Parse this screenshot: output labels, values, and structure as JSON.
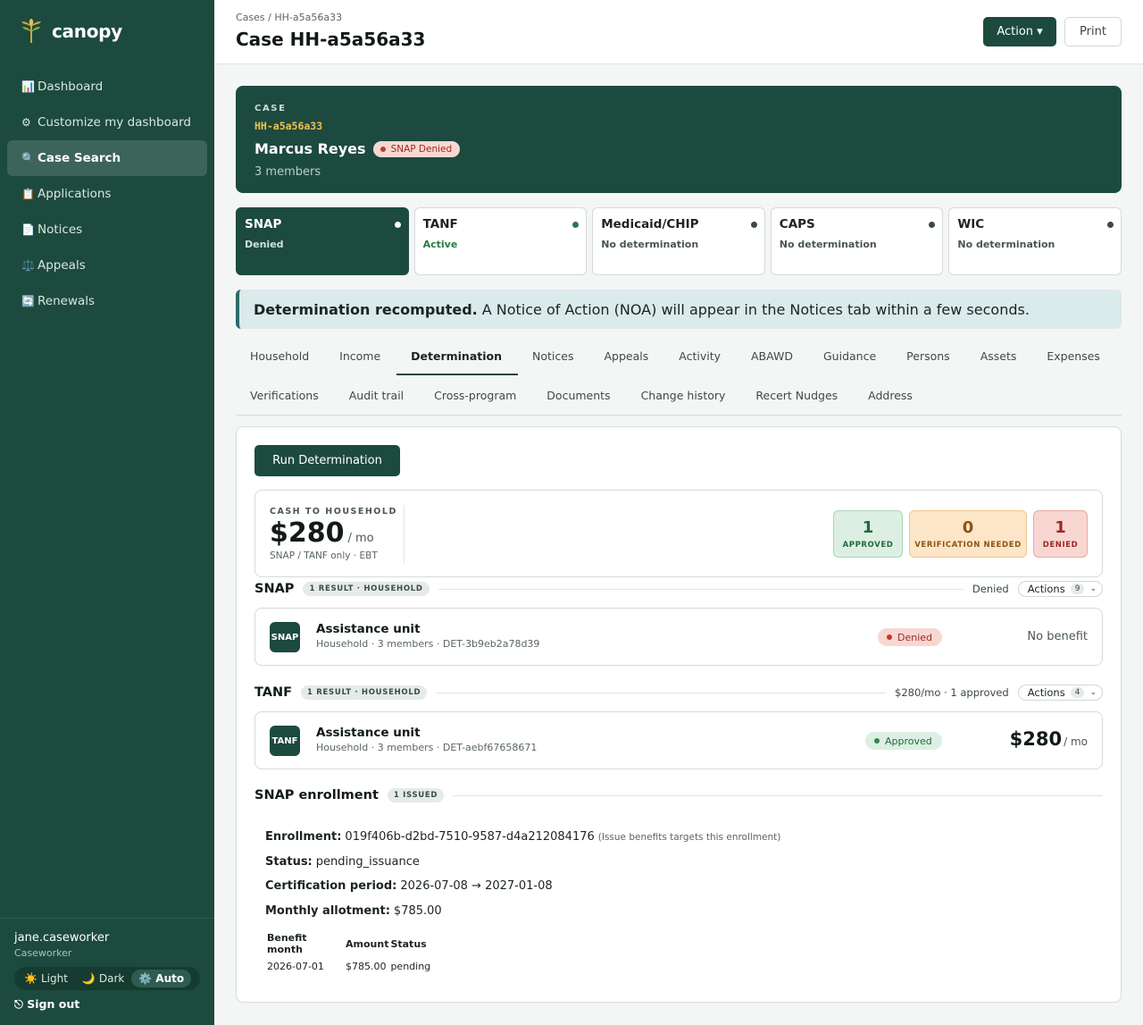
{
  "brand": {
    "name": "canopy"
  },
  "nav": [
    {
      "icon": "📊",
      "label": "Dashboard"
    },
    {
      "icon": "⚙",
      "label": "Customize my dashboard"
    },
    {
      "icon": "🔍",
      "label": "Case Search"
    },
    {
      "icon": "📋",
      "label": "Applications"
    },
    {
      "icon": "📄",
      "label": "Notices"
    },
    {
      "icon": "⚖️",
      "label": "Appeals"
    },
    {
      "icon": "🔄",
      "label": "Renewals"
    }
  ],
  "user": {
    "name": "jane.caseworker",
    "role": "Caseworker"
  },
  "theme": {
    "light": "Light",
    "dark": "Dark",
    "auto": "Auto",
    "light_icon": "☀️",
    "dark_icon": "🌙",
    "auto_icon": "⚙️"
  },
  "signout": "⎋ Sign out",
  "header": {
    "breadcrumb": "Cases / HH-a5a56a33",
    "title": "Case HH-a5a56a33",
    "action_label": "Action ▾",
    "print_label": "Print"
  },
  "case": {
    "label": "CASE",
    "id": "HH-a5a56a33",
    "name": "Marcus Reyes",
    "badge": "SNAP Denied",
    "members": "3 members"
  },
  "programs": [
    {
      "name": "SNAP",
      "status": "Denied"
    },
    {
      "name": "TANF",
      "status": "Active"
    },
    {
      "name": "Medicaid/CHIP",
      "status": "No determination"
    },
    {
      "name": "CAPS",
      "status": "No determination"
    },
    {
      "name": "WIC",
      "status": "No determination"
    }
  ],
  "alert": {
    "strong": "Determination recomputed.",
    "text": "A Notice of Action (NOA) will appear in the Notices tab within a few seconds."
  },
  "tabs": {
    "row1": [
      "Household",
      "Income",
      "Determination",
      "Notices",
      "Appeals",
      "Activity",
      "ABAWD",
      "Guidance",
      "Persons",
      "Assets",
      "Expenses"
    ],
    "row2": [
      "Verifications",
      "Audit trail",
      "Cross-program",
      "Documents",
      "Change history",
      "Recert Nudges",
      "Address"
    ]
  },
  "run_label": "Run Determination",
  "summary": {
    "label": "CASH TO HOUSEHOLD",
    "amount": "$280",
    "per": "/ mo",
    "sub": "SNAP / TANF only · EBT",
    "approved": {
      "count": "1",
      "label": "APPROVED"
    },
    "verification": {
      "count": "0",
      "label": "VERIFICATION NEEDED"
    },
    "denied": {
      "count": "1",
      "label": "DENIED"
    }
  },
  "snap": {
    "title": "SNAP",
    "chip": "1 RESULT · HOUSEHOLD",
    "right": "Denied",
    "actions": "Actions",
    "actions_count": "9",
    "unit_icon": "SNAP",
    "unit_title": "Assistance unit",
    "unit_sub": "Household · 3 members · DET-3b9eb2a78d39",
    "status": "Denied",
    "benefit": "No benefit"
  },
  "tanf": {
    "title": "TANF",
    "chip": "1 RESULT · HOUSEHOLD",
    "right": "$280/mo · 1 approved",
    "actions": "Actions",
    "actions_count": "4",
    "unit_icon": "TANF",
    "unit_title": "Assistance unit",
    "unit_sub": "Household · 3 members · DET-aebf67658671",
    "status": "Approved",
    "amount": "$280",
    "per": "/ mo"
  },
  "enrollment": {
    "title": "SNAP enrollment",
    "chip": "1 ISSUED",
    "enrollment_label": "Enrollment:",
    "enrollment_value": "019f406b-d2bd-7510-9587-d4a212084176",
    "enrollment_note": "(Issue benefits targets this enrollment)",
    "status_label": "Status:",
    "status_value": "pending_issuance",
    "period_label": "Certification period:",
    "period_value": "2026-07-08 → 2027-01-08",
    "allotment_label": "Monthly allotment:",
    "allotment_value": "$785.00",
    "table_headers": [
      "Benefit month",
      "Amount",
      "Status"
    ],
    "table_rows": [
      [
        "2026-07-01",
        "$785.00",
        "pending"
      ]
    ]
  },
  "colors": {
    "brand": "#1d4a3e",
    "accent_gold": "#f2c14e",
    "denied": "#9a2a20",
    "approved": "#1f6b3a"
  }
}
